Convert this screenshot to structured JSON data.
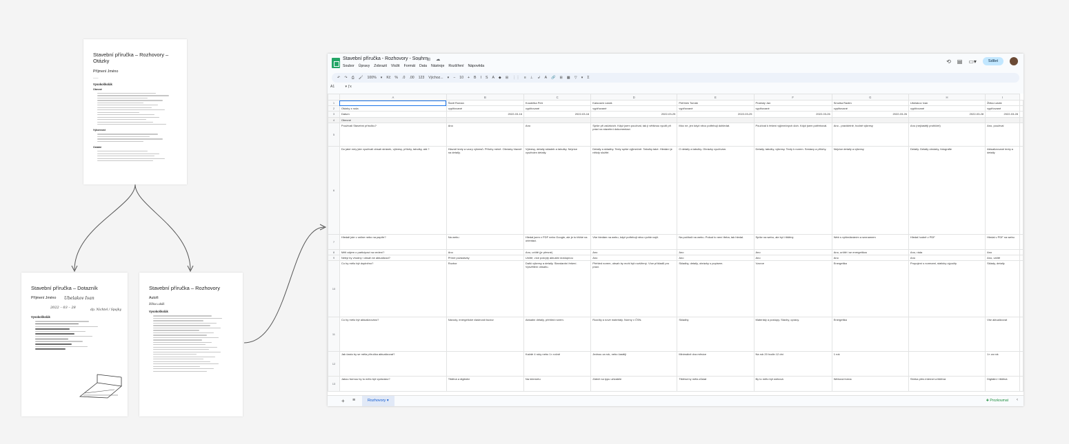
{
  "docs": {
    "questions": {
      "title": "Stavební příručka – Rozhovory – Otázky",
      "field_name": "Příjmení Jméno",
      "section_vysokoskolak": "Vysokoškolák",
      "section_obecne": "Obecné",
      "section_vykonnost": "Výkonnost"
    },
    "questionnaire": {
      "title": "Stavební příručka – Dotazník",
      "field_name": "Příjmení Jméno",
      "hand_name": "Ubelakov Ivan",
      "hand_date": "2022 – 03 – 28",
      "hand_note": "dp. Nichtel / Spojky",
      "section": "Vysokoškolák"
    },
    "interviews": {
      "title": "Stavební příručka – Rozhovory",
      "section_authors": "Autoři",
      "author": "Žižka Lukáš",
      "section": "Vysokoškolák"
    }
  },
  "sheets": {
    "doc_name": "Stavební příručka - Rozhovory - Souhrn",
    "title_icons": "☆ ⊞ ☁",
    "menu": [
      "Soubor",
      "Úpravy",
      "Zobrazit",
      "Vložit",
      "Formát",
      "Data",
      "Nástroje",
      "Rozšíření",
      "Nápověda"
    ],
    "share_label": "Sdílet",
    "toolbar_items": [
      "↶",
      "↷",
      "⎙",
      "🖌",
      "100%",
      "▾",
      "Kč",
      "%",
      ".0",
      ".00",
      "123",
      "Výchoz...",
      "▾",
      "−",
      "10",
      "+",
      "B",
      "I",
      "S",
      "A",
      "◆",
      "⊞",
      "⋮⋮",
      "≡",
      "⊥",
      "↲",
      "A",
      "🔗",
      "⊞",
      "▦",
      "▽",
      "▾",
      "Σ"
    ],
    "cell_ref": "A1",
    "columns": [
      "",
      "A",
      "B",
      "C",
      "D",
      "E",
      "F",
      "G",
      "H",
      "I"
    ],
    "rows": [
      {
        "n": "1",
        "cells": [
          "",
          "Šantl Roman",
          "Koudelka Petr",
          "Kalousek Lukáš",
          "Petříček Tomáš",
          "Pražský Jan",
          "Smolka Radim",
          "Ubelakov Ivan",
          "Žižka Lukáš"
        ]
      },
      {
        "n": "2",
        "cells": [
          "Otázky z roda",
          "vyplňované",
          "vyplňované",
          "vyplňované",
          "vyplňované",
          "vyplňované",
          "vyplňované",
          "vyplňované",
          "vyplňované"
        ]
      },
      {
        "n": "3",
        "cells": [
          "Datum",
          "2022-03-16",
          "2022-03-16",
          "2022-03-25",
          "2022-03-25",
          "2022-03-26",
          "2022-03-26",
          "2022-03-28",
          "2022-03-28"
        ]
      },
      {
        "n": "4",
        "cells": [
          "Obecné",
          "",
          "",
          "",
          "",
          "",
          "",
          "",
          ""
        ]
      },
      {
        "n": "5",
        "cells": [
          "Používali Stavební příručku?",
          "Ano",
          "Ano",
          "Spíše při začátcích. Když jsem používal, tak ji většinou využil při práci na stavební dokumentaci.",
          "Moc ne, jen když něco potřebuji dohledat.",
          "Používal k řešení výjimečných úloh. Když jsem potřeboval.",
          "Ano - pravidelně, hodně výkresy",
          "Ano (nejčastěji prohlížel)",
          "Ano, používal"
        ]
      },
      {
        "n": "6",
        "cells": [
          "Do jaké míry jste využívali obsah stránek, výkresy, přílohy, tabulky, atd.?",
          "Hlavně texty a vzory výkresů. Přílohy méně. Obrázky hlavně na detaily.",
          "Výkresy, detaily skladeb a tabulky. Nejvíce využívám detaily.",
          "Detaily a skladby. Texty spíše výjimečně. Tabulky také. Hledání je někdy složité.",
          "O detaily a tabulky. Obrázky využívám.",
          "Detaily, tabulky, výkresy. Texty k norem. Sestavy a přílohy.",
          "Nejvíce detaily a výkresy",
          "Detaily. Detaily obrázky, fotografie",
          "Aktualizované texty a detaily"
        ]
      },
      {
        "n": "7",
        "cells": [
          "Hledali jste v online nebo na papíře?",
          "Na webu",
          "Hledal jsem v PDF nebo Google, ale je to těžké na orientaci.",
          "Vše hledám na webu, když potřebuji něco rychle najít.",
          "Na počítači na webu. Pokud to není třeba, tak hledal.",
          "Spíše na webu, ale byl i tištěný.",
          "Web s vyhledáváním a seznamem",
          "Hledal hodně v PDF",
          "Hledal v PDF na webu"
        ]
      },
      {
        "n": "8",
        "cells": [
          "Měli zájem o participaci na vedení?",
          "Ano",
          "Ano, určitě (je přesné)",
          "Ano",
          "Ano",
          "Ano",
          "Ano, určitě i se energetikou",
          "Ano, ráda",
          "Ano"
        ]
      },
      {
        "n": "9",
        "cells": [
          "Nebyl by vhodný i obsah ke aktualizaci?",
          "Přímé požadavky",
          "Určitě, více pokrytý aktuální dostupnou",
          "Ano",
          "Ano",
          "Ano",
          "Ano",
          "Ano",
          "Ano, určitě"
        ]
      },
      {
        "n": "10",
        "cells": [
          "Co by mělo být doplněno?",
          "Rozbor",
          "Další výkresy a detaily. Standardní řešení. Vysvětlení obsahu.",
          "Přehled norem, obsah by mohl být rozšířený. Více příkladů pro praxi.",
          "Skladby, detaily, obrázky s popisem.",
          "Vzorce",
          "Energetika",
          "Propojení s normami, staticky výpočty",
          "Sklady, detaily"
        ]
      },
      {
        "n": "11",
        "cells": [
          "Co by mělo být aktualizováno?",
          "Návody, energetické vlastnosti budov",
          "Aktuální detaily, přehled norem.",
          "Rozdíly a nové materiály. Normy v ČSN.",
          "Skladby",
          "Materiály a postupy. Stavby, opravy.",
          "Energetika",
          "",
          "Vše aktualizovat"
        ]
      },
      {
        "n": "12",
        "cells": [
          "Jak často by se měla příručka aktualizovat?",
          "",
          "Každé 4 roky nebo 1× ročně",
          "Jednou za rok, nebo častěji",
          "Minimálně dva měsíce",
          "Na rok 20 hodin 12 dní",
          "1 rok",
          "",
          "1× za rok"
        ]
      },
      {
        "n": "13",
        "cells": [
          "Jakou formou by to mělo být vydáváno?",
          "Tištěná a digitální",
          "Na internetu",
          "Záleží na typu uživatele",
          "Tištěná by měla zůstat",
          "By to mělo být webová",
          "Webová forma",
          "Sbírka přes internet a tištěná",
          "Digitální i tištěná"
        ]
      }
    ],
    "sheet_tab": "Rozhovory",
    "explore_label": "Prozkoumat"
  }
}
